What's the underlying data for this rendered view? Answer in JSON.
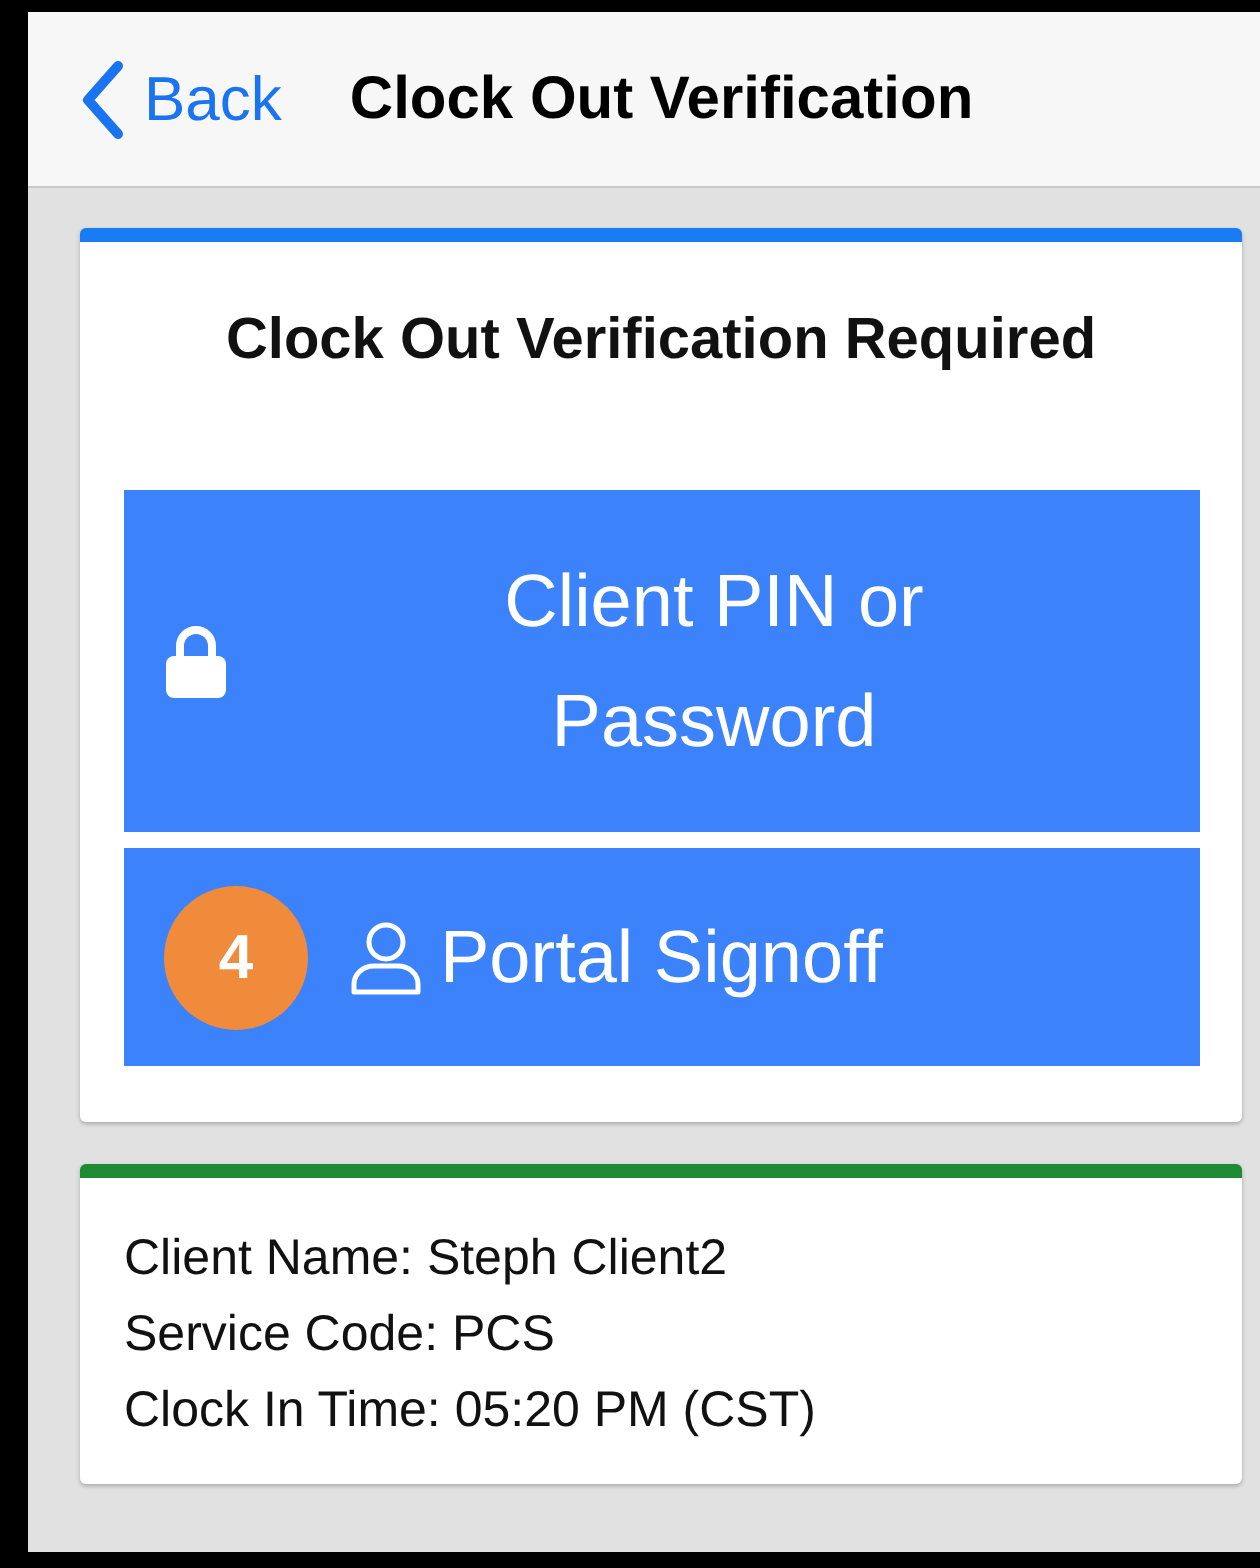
{
  "nav": {
    "back": "Back",
    "title": "Clock Out Verification"
  },
  "verification": {
    "title": "Clock Out Verification Required",
    "options": [
      {
        "kind": "pin",
        "label": "Client PIN or Password"
      },
      {
        "kind": "portal",
        "label": "Portal Signoff",
        "badge": "4"
      }
    ]
  },
  "details": [
    "Client Name: Steph Client2",
    "Service Code: PCS",
    "Clock In Time: 05:20 PM (CST)"
  ]
}
